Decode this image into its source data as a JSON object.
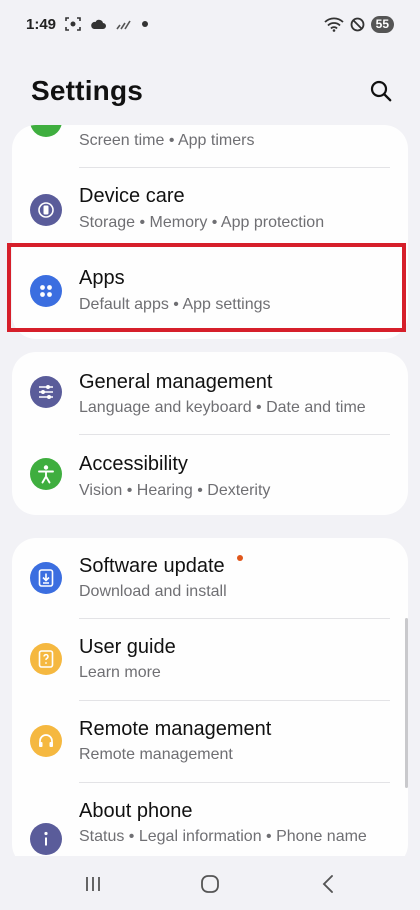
{
  "status_bar": {
    "time": "1:49",
    "battery": "55",
    "icons": [
      "screenshot-icon",
      "cloud-icon",
      "signal-off-icon",
      "notification-dot-icon",
      "wifi-icon",
      "do-not-disturb-icon",
      "battery-icon"
    ]
  },
  "header": {
    "title": "Settings",
    "search_icon": "search-icon"
  },
  "card1": {
    "screen_time_sub": "Screen time  •  App timers",
    "device_care": {
      "title": "Device care",
      "subtitle": "Storage  •  Memory  •  App protection",
      "icon": "device-care-icon",
      "color": "#5a5c9a"
    },
    "apps": {
      "title": "Apps",
      "subtitle": "Default apps  •  App settings",
      "icon": "apps-grid-icon",
      "color": "#3b6ee0"
    }
  },
  "card2": {
    "general": {
      "title": "General management",
      "subtitle": "Language and keyboard  •  Date and time",
      "icon": "sliders-icon",
      "color": "#5a5c9a"
    },
    "accessibility": {
      "title": "Accessibility",
      "subtitle": "Vision  •  Hearing  •  Dexterity",
      "icon": "accessibility-icon",
      "color": "#3fae3f"
    }
  },
  "card3": {
    "software_update": {
      "title": "Software update",
      "subtitle": "Download and install",
      "icon": "download-icon",
      "color": "#3b6ee0"
    },
    "user_guide": {
      "title": "User guide",
      "subtitle": "Learn more",
      "icon": "guide-icon",
      "color": "#f5b840"
    },
    "remote": {
      "title": "Remote management",
      "subtitle": "Remote management",
      "icon": "headset-icon",
      "color": "#f5b840"
    },
    "about": {
      "title": "About phone",
      "subtitle": "Status  •  Legal information  •  Phone name",
      "icon": "info-icon",
      "color": "#5a5c9a"
    }
  },
  "colors": {
    "highlight": "#d61f2a",
    "background": "#f2f2f6",
    "card": "#fefefe"
  },
  "nav": {
    "icons": [
      "recents-icon",
      "home-icon",
      "back-icon"
    ]
  }
}
